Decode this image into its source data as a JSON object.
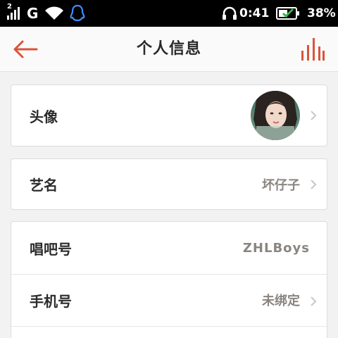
{
  "status_bar": {
    "network_type": "G",
    "sim_slot": "2",
    "time": "0:41",
    "battery": "38%",
    "icons": [
      "signal-icon",
      "wifi-icon",
      "qq-icon",
      "headset-icon",
      "battery-icon"
    ]
  },
  "header": {
    "title": "个人信息",
    "back_icon": "back-arrow-icon",
    "stats_icon": "bar-chart-icon",
    "accent_color": "#d9533b"
  },
  "profile": {
    "avatar": {
      "label": "头像"
    },
    "stage_name": {
      "label": "艺名",
      "value": "坏仔子"
    },
    "account": {
      "label": "唱吧号",
      "value": "ZHLBoys"
    },
    "phone": {
      "label": "手机号",
      "value": "未绑定"
    }
  }
}
